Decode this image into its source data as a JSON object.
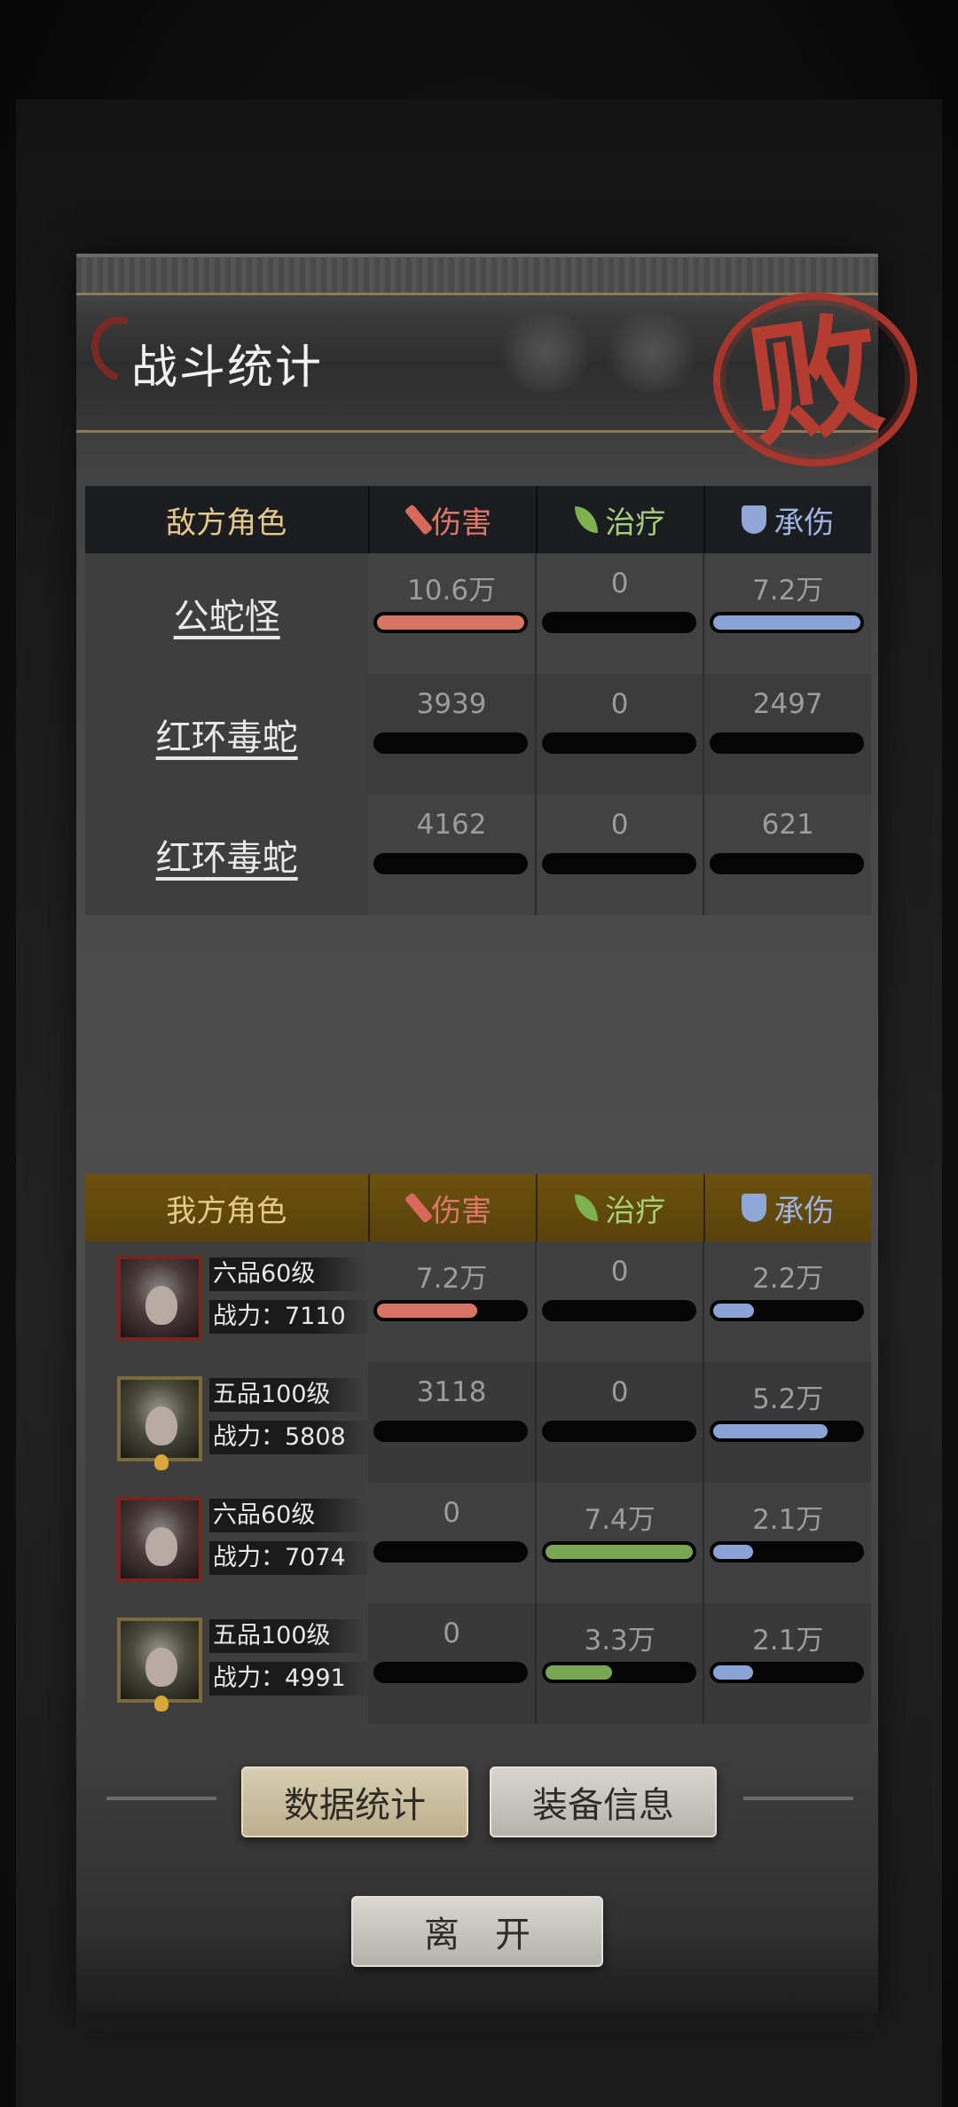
{
  "header": {
    "title": "战斗统计",
    "result_stamp": "败"
  },
  "columns": {
    "damage": "伤害",
    "heal": "治疗",
    "tank": "承伤"
  },
  "enemy": {
    "header_label": "敌方角色",
    "rows": [
      {
        "name": "公蛇怪",
        "damage": "10.6万",
        "heal": "0",
        "tank": "7.2万",
        "damage_ratio": 1.0,
        "heal_ratio": 0,
        "tank_ratio": 1.0
      },
      {
        "name": "红环毒蛇",
        "damage": "3939",
        "heal": "0",
        "tank": "2497",
        "damage_ratio": 0,
        "heal_ratio": 0,
        "tank_ratio": 0
      },
      {
        "name": "红环毒蛇",
        "damage": "4162",
        "heal": "0",
        "tank": "621",
        "damage_ratio": 0,
        "heal_ratio": 0,
        "tank_ratio": 0
      }
    ]
  },
  "ally": {
    "header_label": "我方角色",
    "rows": [
      {
        "rank": "六品60级",
        "power": "战力：7110",
        "damage": "7.2万",
        "heal": "0",
        "tank": "2.2万",
        "damage_ratio": 0.68,
        "heal_ratio": 0,
        "tank_ratio": 0.28,
        "frame": "red"
      },
      {
        "rank": "五品100级",
        "power": "战力：5808",
        "damage": "3118",
        "heal": "0",
        "tank": "5.2万",
        "damage_ratio": 0,
        "heal_ratio": 0,
        "tank_ratio": 0.78,
        "frame": "gold"
      },
      {
        "rank": "六品60级",
        "power": "战力：7074",
        "damage": "0",
        "heal": "7.4万",
        "tank": "2.1万",
        "damage_ratio": 0,
        "heal_ratio": 1.0,
        "tank_ratio": 0.27,
        "frame": "red"
      },
      {
        "rank": "五品100级",
        "power": "战力：4991",
        "damage": "0",
        "heal": "3.3万",
        "tank": "2.1万",
        "damage_ratio": 0,
        "heal_ratio": 0.45,
        "tank_ratio": 0.27,
        "frame": "gold"
      }
    ]
  },
  "buttons": {
    "stats": "数据统计",
    "equipment": "装备信息",
    "leave": "离开"
  },
  "colors": {
    "damage": "#d77565",
    "heal": "#79a653",
    "tank": "#8aa2d6",
    "stamp": "#b43c30",
    "ally_header": "#6b520f"
  }
}
